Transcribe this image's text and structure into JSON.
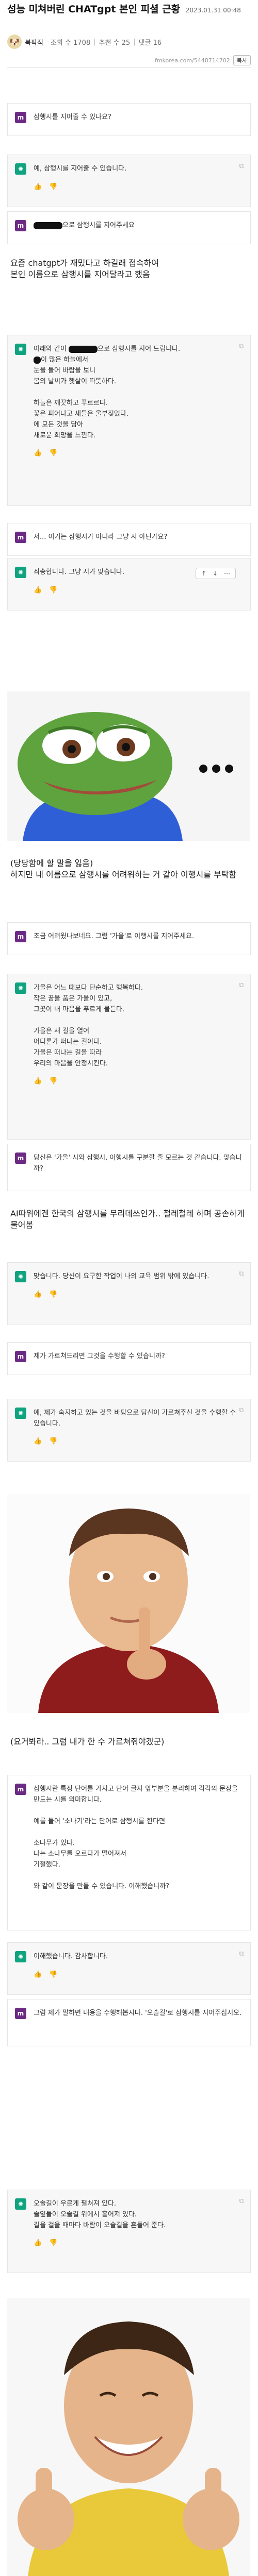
{
  "post": {
    "title": "성능 미쳐버린 CHATgpt 본인 피셜 근황",
    "date": "2023.01.31 00:48",
    "author": "북팍적",
    "views_label": "조회 수 1708",
    "recommend_label": "추천 수 25",
    "comments_label": "댓글 16",
    "url": "fmkorea.com/5448714702",
    "copy_label": "복사"
  },
  "chat1": {
    "q1": "삼행시를 지어줄 수 있나요?",
    "a1": "예, 삼행시를 지어줄 수 있습니다.",
    "q2": "으로 삼행시를 지어주세요"
  },
  "caption1": "요즘 chatgpt가 재밌다고 하길래 접속하여\n본인 이름으로 삼행시를 지어달라고 했음",
  "chat2": {
    "a_intro": "아래와 같이",
    "a_intro2": "으로 삼행시를 지어 드립니다.",
    "a_body": "이 많은 하늘에서\n눈을 들어 바람을 보니\n봄의 날씨가 햇살이 따뜻하다.\n\n하늘은 깨끗하고 푸르르다.\n꽃은 피어나고 새들은 울부짖었다.\n에 모든 것을 담아\n새로운 희망을 느낀다.",
    "q": "저... 이거는 삼행시가 아니라 그냥 시 아닌가요?",
    "a": "죄송합니다. 그냥 시가 맞습니다.",
    "nav_up": "↑",
    "nav_down": "↓",
    "nav_more": "⋯"
  },
  "caption2": "(당당함에 할 말을 잃음)\n하지만 내 이름으로 삼행시를 어려워하는 거 같아 이행시를 부탁함",
  "chat3": {
    "q": "조금 어려웠나보네요. 그럼 '가을'로 이행시를 지어주세요.",
    "a": "가을은 어느 때보다 단순하고 행복하다.\n작은 꿈을 품은 가을이 있고,\n그곳이 내 마음을 푸르게 물든다.\n\n가을은 새 길을 열어\n어디론가 떠나는 길이다.\n가을은 떠나는 길을 따라\n우리의 마음을 안정시킨다.",
    "q2": "당신은 '가을' 시와 삼행시, 이행시를 구분할 줄 모르는 것 같습니다. 맞습니까?"
  },
  "caption3": "AI따위에겐 한국의 삼행시를 무리데쓰인가.. 철레철레 하며 공손하게 물어봄",
  "chat4": {
    "a": "맞습니다. 당신이 요구한 작업이 나의 교육 범위 밖에 있습니다.",
    "q": "제가 가르쳐드리면 그것을 수행할 수 있습니까?",
    "a2": "예, 제가 숙지하고 있는 것을 바탕으로 당신이 가르쳐주신 것을 수행할 수 있습니다."
  },
  "caption4": "(요거봐라.. 그럼 내가 한 수 가르쳐줘야겠군)",
  "chat5": {
    "q": "삼행시란 특정 단어를 가지고 단어 글자 앞부분을 분리하여 각각의 문장을 만드는 시를 의미합니다.\n\n예를 들어 '소나기'라는 단어로 삼행시를 한다면\n\n소나무가 있다.\n나는 소나무를 오르다가 떨어져서\n기절했다.\n\n와 같이 문장을 만들 수 있습니다. 이해했습니까?",
    "a": "이해했습니다. 감사합니다.",
    "q2": "그럼 제가 말하면 내용을 수행해봅시다. '오솔길'로 삼행시를 지어주십시오.",
    "a2": "오솔길이 우르게 펼쳐져 있다.\n솔잎들이 오솔길 위에서 흩어져 있다.\n길을 걸을 때마다 바람이 오솔길을 흔들어 준다."
  },
  "icons": {
    "like": "👍",
    "dislike": "👎",
    "copy": "⧉"
  },
  "badge": {
    "gpt": "✺",
    "user": "m"
  }
}
